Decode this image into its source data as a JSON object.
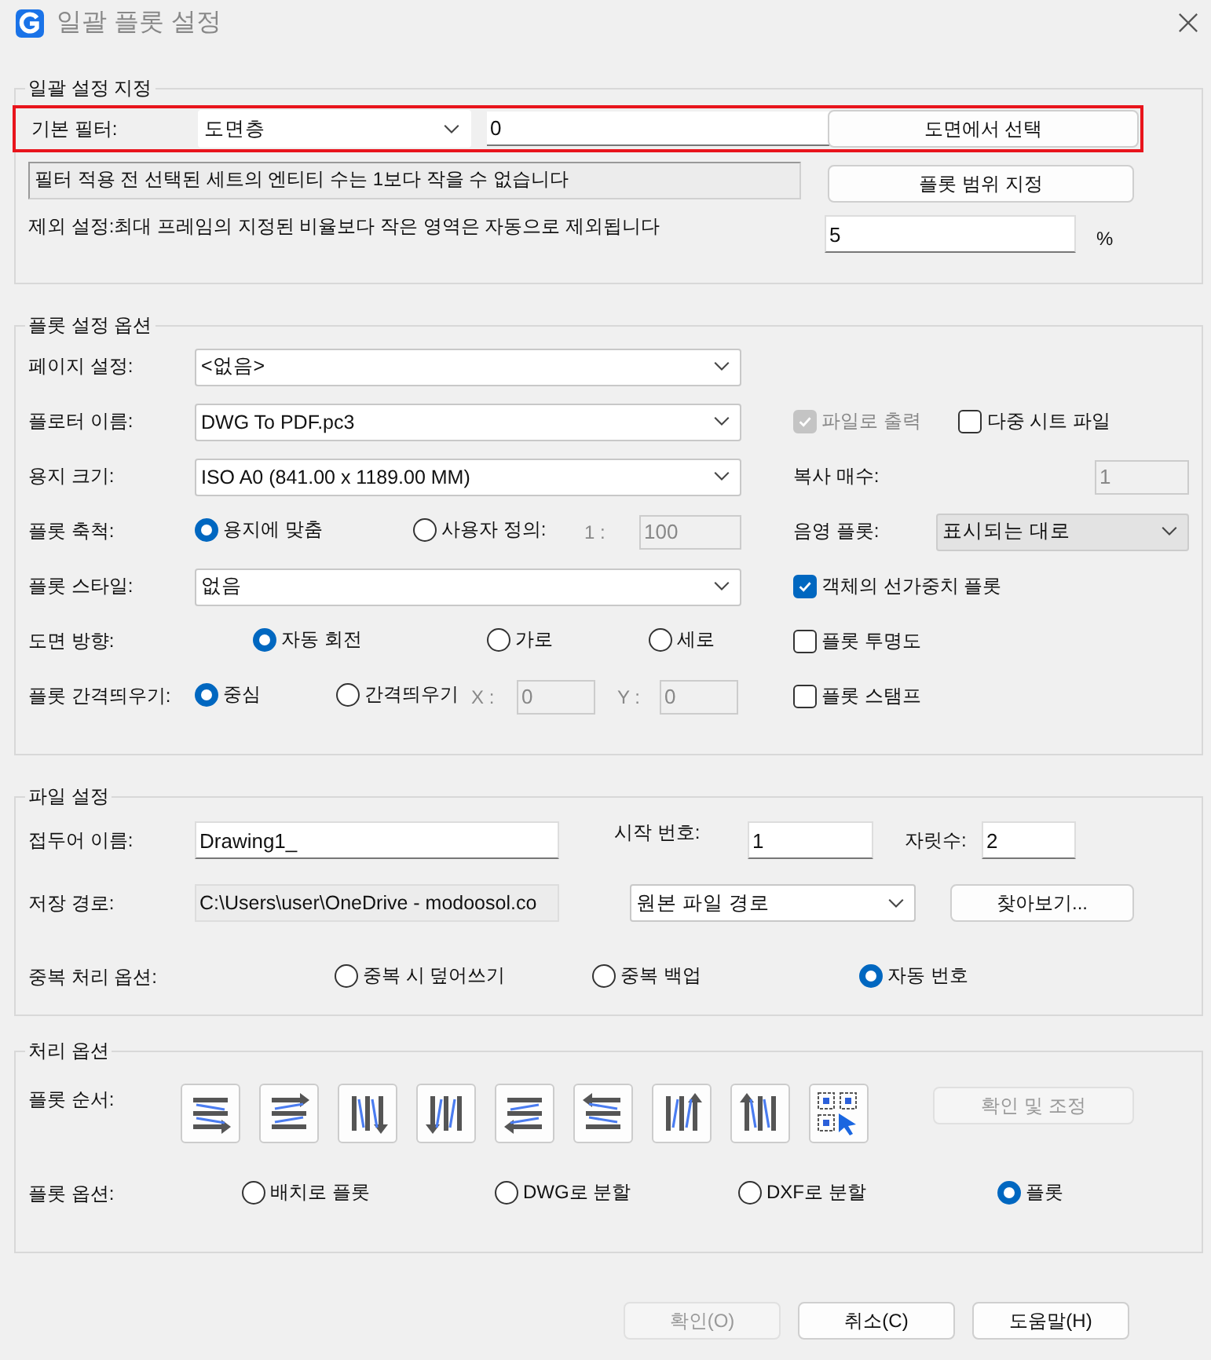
{
  "window": {
    "title": "일괄 플롯 설정"
  },
  "batch_settings": {
    "title": "일괄 설정 지정",
    "filter": {
      "label": "기본 필터:",
      "value": "도면층",
      "text": "0",
      "highlighted": true
    },
    "select_button": "도면에서 선택",
    "message": "필터 적용 전 선택된 세트의 엔티티 수는 1보다 작을 수 없습니다",
    "range_button": "플롯 범위 지정",
    "exclude": {
      "label": "제외 설정:최대 프레임의 지정된 비율보다 작은 영역은 자동으로 제외됩니다",
      "value": "5",
      "unit": "%"
    }
  },
  "plot_options": {
    "title": "플롯 설정 옵션",
    "page_setup": {
      "label": "페이지 설정:",
      "value": "<없음>"
    },
    "plotter": {
      "label": "플로터 이름:",
      "value": "DWG To PDF.pc3"
    },
    "paper_size": {
      "label": "용지 크기:",
      "value": "ISO A0 (841.00 x 1189.00 MM)"
    },
    "plot_scale": {
      "label": "플롯 축척:",
      "options": [
        {
          "label": "용지에 맞춤",
          "selected": true
        },
        {
          "label": "사용자 정의:",
          "selected": false
        }
      ],
      "ratio_prefix": "1 :",
      "ratio_value": "100"
    },
    "plot_style": {
      "label": "플롯 스타일:",
      "value": "없음"
    },
    "orientation": {
      "label": "도면 방향:",
      "options": [
        {
          "label": "자동 회전",
          "selected": true
        },
        {
          "label": "가로",
          "selected": false
        },
        {
          "label": "세로",
          "selected": false
        }
      ]
    },
    "offset": {
      "label": "플롯 간격띄우기:",
      "options": [
        {
          "label": "중심",
          "selected": true
        },
        {
          "label": "간격띄우기",
          "selected": false
        }
      ],
      "x_label": "X :",
      "x_value": "0",
      "y_label": "Y :",
      "y_value": "0"
    },
    "plot_to_file": {
      "label": "파일로 출력",
      "checked": true,
      "disabled": true
    },
    "multi_sheet": {
      "label": "다중 시트 파일",
      "checked": false,
      "disabled": false
    },
    "copies": {
      "label": "복사 매수:",
      "value": "1",
      "disabled": true
    },
    "shade_plot": {
      "label": "음영 플롯:",
      "value": "표시되는 대로"
    },
    "lineweights": {
      "label": "객체의 선가중치 플롯",
      "checked": true,
      "disabled": false
    },
    "transparency": {
      "label": "플롯 투명도",
      "checked": false,
      "disabled": false
    },
    "stamp": {
      "label": "플롯 스탬프",
      "checked": false,
      "disabled": false
    }
  },
  "file_settings": {
    "title": "파일 설정",
    "prefix": {
      "label": "접두어 이름:",
      "value": "Drawing1_"
    },
    "start_number": {
      "label": "시작 번호:",
      "value": "1"
    },
    "digits": {
      "label": "자릿수:",
      "value": "2"
    },
    "save_path": {
      "label": "저장 경로:",
      "value": "C:\\Users\\user\\OneDrive - modoosol.co",
      "location": "원본 파일 경로"
    },
    "browse_button": "찾아보기...",
    "duplicate": {
      "label": "중복 처리 옵션:",
      "options": [
        {
          "label": "중복 시 덮어쓰기",
          "selected": false
        },
        {
          "label": "중복 백업",
          "selected": false
        },
        {
          "label": "자동 번호",
          "selected": true
        }
      ]
    }
  },
  "processing": {
    "title": "처리 옵션",
    "order_label": "플롯 순서:",
    "check_button": {
      "label": "확인 및 조정",
      "disabled": true
    },
    "plot_option": {
      "label": "플롯 옵션:",
      "options": [
        {
          "label": "배치로 플롯",
          "selected": false
        },
        {
          "label": "DWG로 분할",
          "selected": false
        },
        {
          "label": "DXF로 분할",
          "selected": false
        },
        {
          "label": "플롯",
          "selected": true
        }
      ]
    }
  },
  "buttons": [
    {
      "label": "확인(O)",
      "disabled": true
    },
    {
      "label": "취소(C)",
      "disabled": false
    },
    {
      "label": "도움말(H)",
      "disabled": false
    }
  ]
}
